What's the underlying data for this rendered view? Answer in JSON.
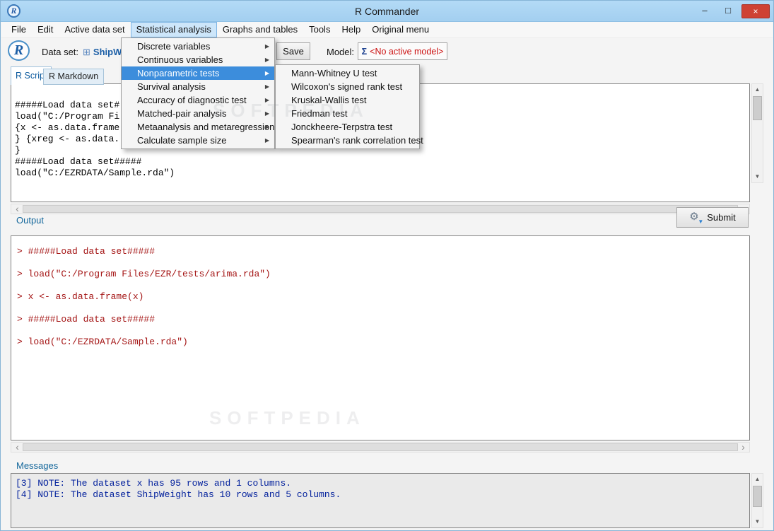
{
  "window": {
    "title": "R Commander",
    "icon_letter": "R",
    "minimize_glyph": "–",
    "maximize_glyph": "□",
    "close_glyph": "×"
  },
  "menubar": {
    "items": [
      "File",
      "Edit",
      "Active data set",
      "Statistical analysis",
      "Graphs and tables",
      "Tools",
      "Help",
      "Original menu"
    ]
  },
  "toolbar": {
    "logo_letter": "R",
    "dataset_label": "Data set:",
    "dataset_value": "ShipW",
    "save_label": "Save",
    "model_label": "Model:",
    "sigma": "Σ",
    "model_value": "<No active model>"
  },
  "dropdown": {
    "arrow_glyph": "▶",
    "highlighted_index": 2,
    "items": [
      "Discrete variables",
      "Continuous variables",
      "Nonparametric tests",
      "Survival analysis",
      "Accuracy of diagnostic test",
      "Matched-pair analysis",
      "Metaanalysis and metaregression",
      "Calculate sample size"
    ]
  },
  "submenu": {
    "items": [
      "Mann-Whitney U test",
      "Wilcoxon's signed rank test",
      "Kruskal-Wallis test",
      "Friedman test",
      "Jonckheere-Terpstra test",
      "Spearman's rank correlation test"
    ]
  },
  "tabs": {
    "rscript": "R Script",
    "rmarkdown": "R Markdown"
  },
  "script": {
    "lines": [
      "#####Load data set#",
      "load(\"C:/Program Fi",
      "{x <- as.data.frame",
      "} {xreg <- as.data.",
      "}",
      "#####Load data set#####",
      "load(\"C:/EZRDATA/Sample.rda\")"
    ]
  },
  "output": {
    "label": "Output",
    "submit_label": "Submit",
    "lines": [
      "> #####Load data set#####",
      "> load(\"C:/Program Files/EZR/tests/arima.rda\")",
      "> x <- as.data.frame(x)",
      "> #####Load data set#####",
      "> load(\"C:/EZRDATA/Sample.rda\")"
    ]
  },
  "messages": {
    "label": "Messages",
    "lines": [
      "[3] NOTE: The dataset x has 95 rows and 1 columns.",
      "[4] NOTE: The dataset ShipWeight has 10 rows and 5 columns."
    ]
  },
  "icons": {
    "gear": "⚙",
    "arrow_down": "▼",
    "dataset_table": "⊞"
  },
  "scrollbar": {
    "up": "▲",
    "down": "▼",
    "left": "‹",
    "right": "›"
  },
  "watermark": "SOFTPEDIA",
  "colors": {
    "titlebar": "#a9d4f2",
    "menu_highlight": "#3c8ddc",
    "close_button": "#ce4234",
    "output_text": "#a41414",
    "messages_text": "#001f9c",
    "accent_blue": "#15689c",
    "model_red": "#cc1111"
  }
}
